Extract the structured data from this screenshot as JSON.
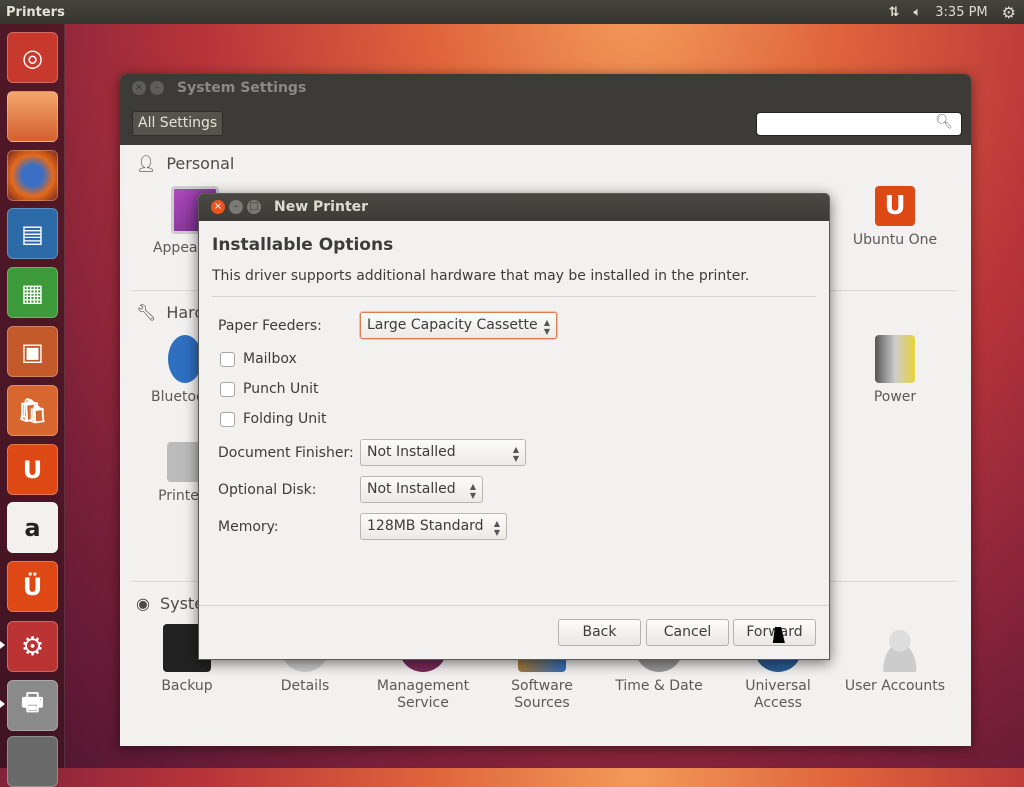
{
  "topbar": {
    "app_title": "Printers",
    "clock": "3:35 PM",
    "icons": [
      "network-updown-icon",
      "volume-icon",
      "session-gear-icon"
    ]
  },
  "launcher": {
    "items": [
      "ubuntu-dash",
      "files",
      "firefox",
      "libreoffice-writer",
      "libreoffice-calc",
      "libreoffice-impress",
      "software-center",
      "ubuntu-one",
      "amazon",
      "ubuntu-one-music",
      "system-settings",
      "printers",
      "trash"
    ]
  },
  "settings": {
    "window_title": "System Settings",
    "all_settings": "All Settings",
    "search_placeholder": "",
    "sections": {
      "personal": "Personal",
      "hardware": "Hardware",
      "system": "System"
    },
    "personal_items": [
      "Appearance",
      "Ubuntu One"
    ],
    "hardware_items": [
      "Bluetooth",
      "Printers",
      "Power"
    ],
    "system_items": [
      "Backup",
      "Details",
      "Management Service",
      "Software Sources",
      "Time & Date",
      "Universal Access",
      "User Accounts"
    ]
  },
  "dialog": {
    "title": "New Printer",
    "heading": "Installable Options",
    "description": "This driver supports additional hardware that may be installed in the printer.",
    "paper_feeders_label": "Paper Feeders:",
    "paper_feeders_value": "Large Capacity Cassette",
    "checkboxes": [
      {
        "label": "Mailbox",
        "checked": false
      },
      {
        "label": "Punch Unit",
        "checked": false
      },
      {
        "label": "Folding Unit",
        "checked": false
      }
    ],
    "document_finisher_label": "Document Finisher:",
    "document_finisher_value": "Not Installed",
    "optional_disk_label": "Optional Disk:",
    "optional_disk_value": "Not Installed",
    "memory_label": "Memory:",
    "memory_value": "128MB Standard",
    "buttons": {
      "back": "Back",
      "cancel": "Cancel",
      "forward": "Forward"
    }
  },
  "colors": {
    "accent": "#e95420",
    "topbar": "#3c3b37",
    "window_bg": "#f2f1f0"
  }
}
